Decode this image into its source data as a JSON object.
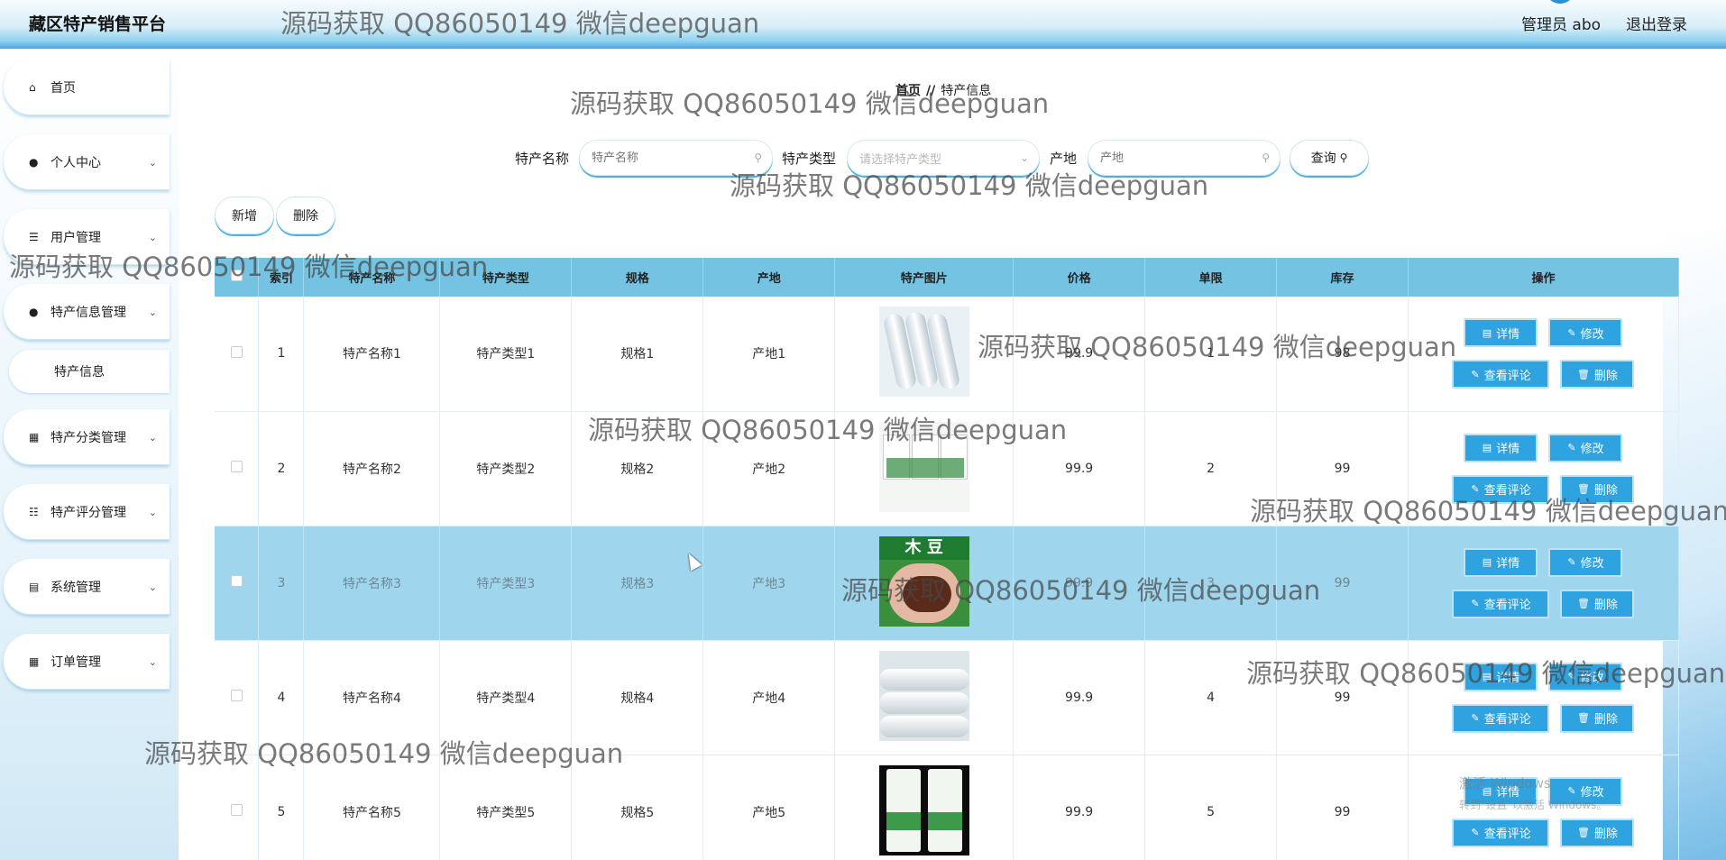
{
  "app": {
    "title": "藏区特产销售平台",
    "admin_label": "管理员 abo",
    "logout_label": "退出登录"
  },
  "sidebar": {
    "items": [
      {
        "label": "首页",
        "icon": "home-icon",
        "has_chevron": false
      },
      {
        "label": "个人中心",
        "icon": "user-icon",
        "has_chevron": true
      },
      {
        "label": "用户管理",
        "icon": "list-icon",
        "has_chevron": true
      },
      {
        "label": "特产信息管理",
        "icon": "user-icon",
        "has_chevron": true
      },
      {
        "label": "特产分类管理",
        "icon": "grid-icon",
        "has_chevron": true
      },
      {
        "label": "特产评分管理",
        "icon": "sliders-icon",
        "has_chevron": true
      },
      {
        "label": "系统管理",
        "icon": "clipboard-icon",
        "has_chevron": true
      },
      {
        "label": "订单管理",
        "icon": "grid-icon",
        "has_chevron": true
      }
    ],
    "sub_item": "特产信息"
  },
  "breadcrumb": {
    "home": "首页",
    "sep": "//",
    "current": "特产信息"
  },
  "search": {
    "name_label": "特产名称",
    "name_placeholder": "特产名称",
    "type_label": "特产类型",
    "type_placeholder": "请选择特产类型",
    "origin_label": "产地",
    "origin_placeholder": "产地",
    "query_label": "查询"
  },
  "actions": {
    "add": "新增",
    "delete": "删除"
  },
  "table": {
    "headers": [
      "索引",
      "特产名称",
      "特产类型",
      "规格",
      "产地",
      "特产图片",
      "价格",
      "单限",
      "库存",
      "操作"
    ],
    "rows": [
      {
        "index": "1",
        "name": "特产名称1",
        "type": "特产类型1",
        "spec": "规格1",
        "origin": "产地1",
        "image": "rolled-film-image",
        "price": "99.9",
        "limit": "1",
        "stock": "98"
      },
      {
        "index": "2",
        "name": "特产名称2",
        "type": "特产类型2",
        "spec": "规格2",
        "origin": "产地2",
        "image": "fertilizer-bags-image",
        "price": "99.9",
        "limit": "2",
        "stock": "99"
      },
      {
        "index": "3",
        "name": "特产名称3",
        "type": "特产类型3",
        "spec": "规格3",
        "origin": "产地3",
        "image": "beans-in-hand-image",
        "price": "99.9",
        "limit": "3",
        "stock": "99"
      },
      {
        "index": "4",
        "name": "特产名称4",
        "type": "特产类型4",
        "spec": "规格4",
        "origin": "产地4",
        "image": "film-rolls-image",
        "price": "99.9",
        "limit": "4",
        "stock": "99"
      },
      {
        "index": "5",
        "name": "特产名称5",
        "type": "特产类型5",
        "spec": "规格5",
        "origin": "产地5",
        "image": "rice-bags-image",
        "price": "99.9",
        "limit": "5",
        "stock": "99"
      }
    ],
    "op_labels": {
      "detail": "详情",
      "edit": "修改",
      "comments": "查看评论",
      "delete": "删除"
    }
  },
  "watermark": "源码获取 QQ86050149 微信deepguan",
  "os_overlay": {
    "line1": "激活 Windows",
    "line2": "转到\"设置\"以激活 Windows。"
  },
  "colors": {
    "accent": "#2fa3df",
    "header_row": "#74c3e3",
    "selected_row": "#9fd6ee"
  }
}
